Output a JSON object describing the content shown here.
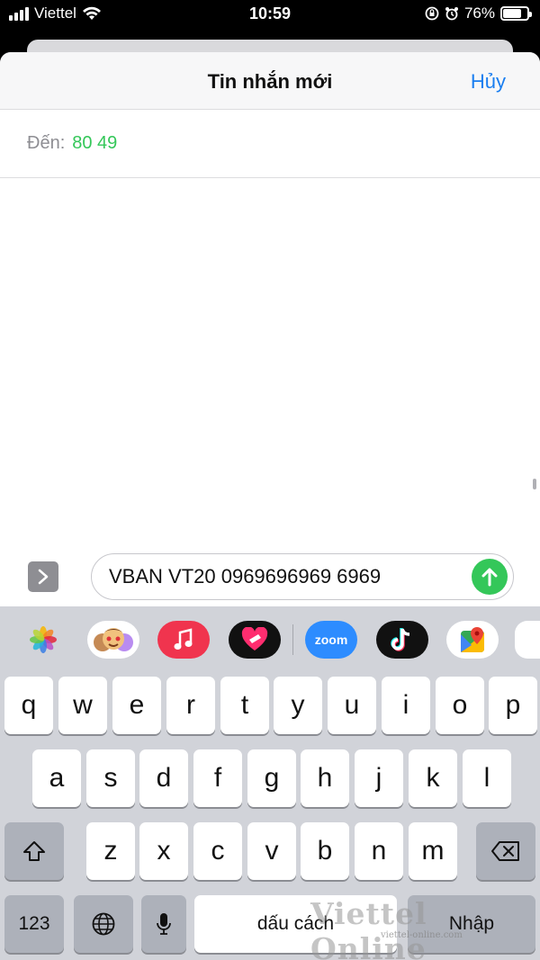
{
  "status_bar": {
    "carrier": "Viettel",
    "time": "10:59",
    "battery": "76%",
    "battery_level": 0.76
  },
  "nav": {
    "title": "Tin nhắn mới",
    "cancel": "Hủy"
  },
  "recipient": {
    "label": "Đến:",
    "value": "80 49"
  },
  "compose": {
    "message": "VBAN VT20 0969696969 6969"
  },
  "app_strip": [
    {
      "name": "photos-app-icon",
      "bg": "#ffffff"
    },
    {
      "name": "memoji-app-icon",
      "bg": "#ffffff"
    },
    {
      "name": "music-app-icon",
      "bg": "#f0344e"
    },
    {
      "name": "digital-touch-app-icon",
      "bg": "#111111"
    },
    {
      "name": "zoom-app-icon",
      "bg": "#2d8cff",
      "label": "zoom"
    },
    {
      "name": "tiktok-app-icon",
      "bg": "#111111"
    },
    {
      "name": "google-maps-app-icon",
      "bg": "#ffffff"
    }
  ],
  "keyboard": {
    "row1": [
      "q",
      "w",
      "e",
      "r",
      "t",
      "y",
      "u",
      "i",
      "o",
      "p"
    ],
    "row2": [
      "a",
      "s",
      "d",
      "f",
      "g",
      "h",
      "j",
      "k",
      "l"
    ],
    "row3": [
      "z",
      "x",
      "c",
      "v",
      "b",
      "n",
      "m"
    ],
    "numbers_key": "123",
    "space_key": "dấu cách",
    "return_key": "Nhập"
  },
  "watermark": {
    "title": "Viettel Online",
    "url": "viettel-online.com"
  }
}
